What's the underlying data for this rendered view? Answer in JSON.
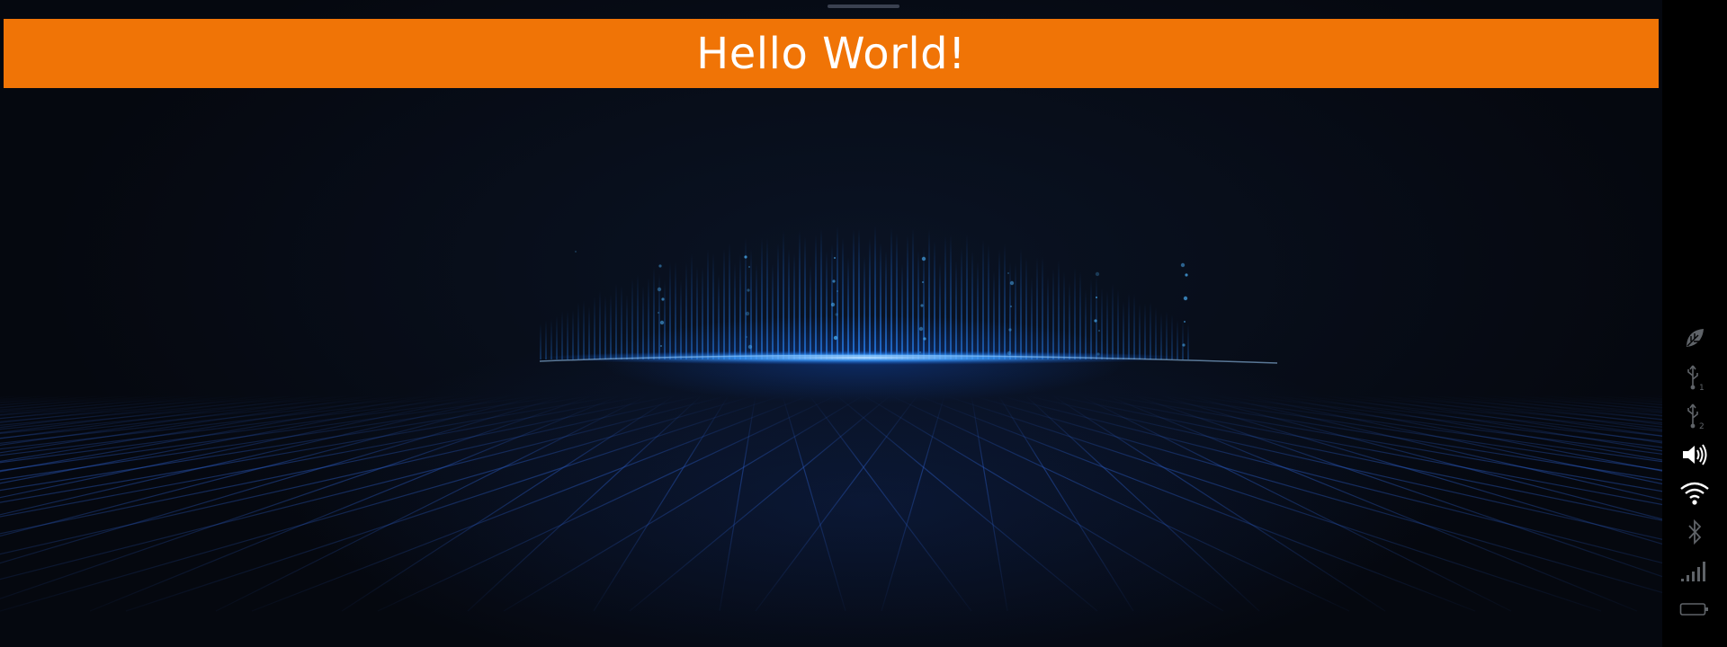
{
  "title_bar": {
    "text": "Hello World!",
    "background": "#f07406"
  },
  "status_bar": {
    "icons": [
      {
        "name": "leaf-icon",
        "state": "inactive"
      },
      {
        "name": "usb-icon",
        "label": "1",
        "state": "inactive"
      },
      {
        "name": "usb-icon",
        "label": "2",
        "state": "inactive"
      },
      {
        "name": "volume-icon",
        "state": "active"
      },
      {
        "name": "wifi-icon",
        "state": "active"
      },
      {
        "name": "bluetooth-icon",
        "state": "inactive"
      },
      {
        "name": "signal-icon",
        "state": "inactive"
      },
      {
        "name": "battery-icon",
        "state": "inactive"
      }
    ]
  },
  "colors": {
    "active_icon": "#ffffff",
    "inactive_icon": "#5f6368",
    "wallpaper_glow": "#1e7bff"
  }
}
